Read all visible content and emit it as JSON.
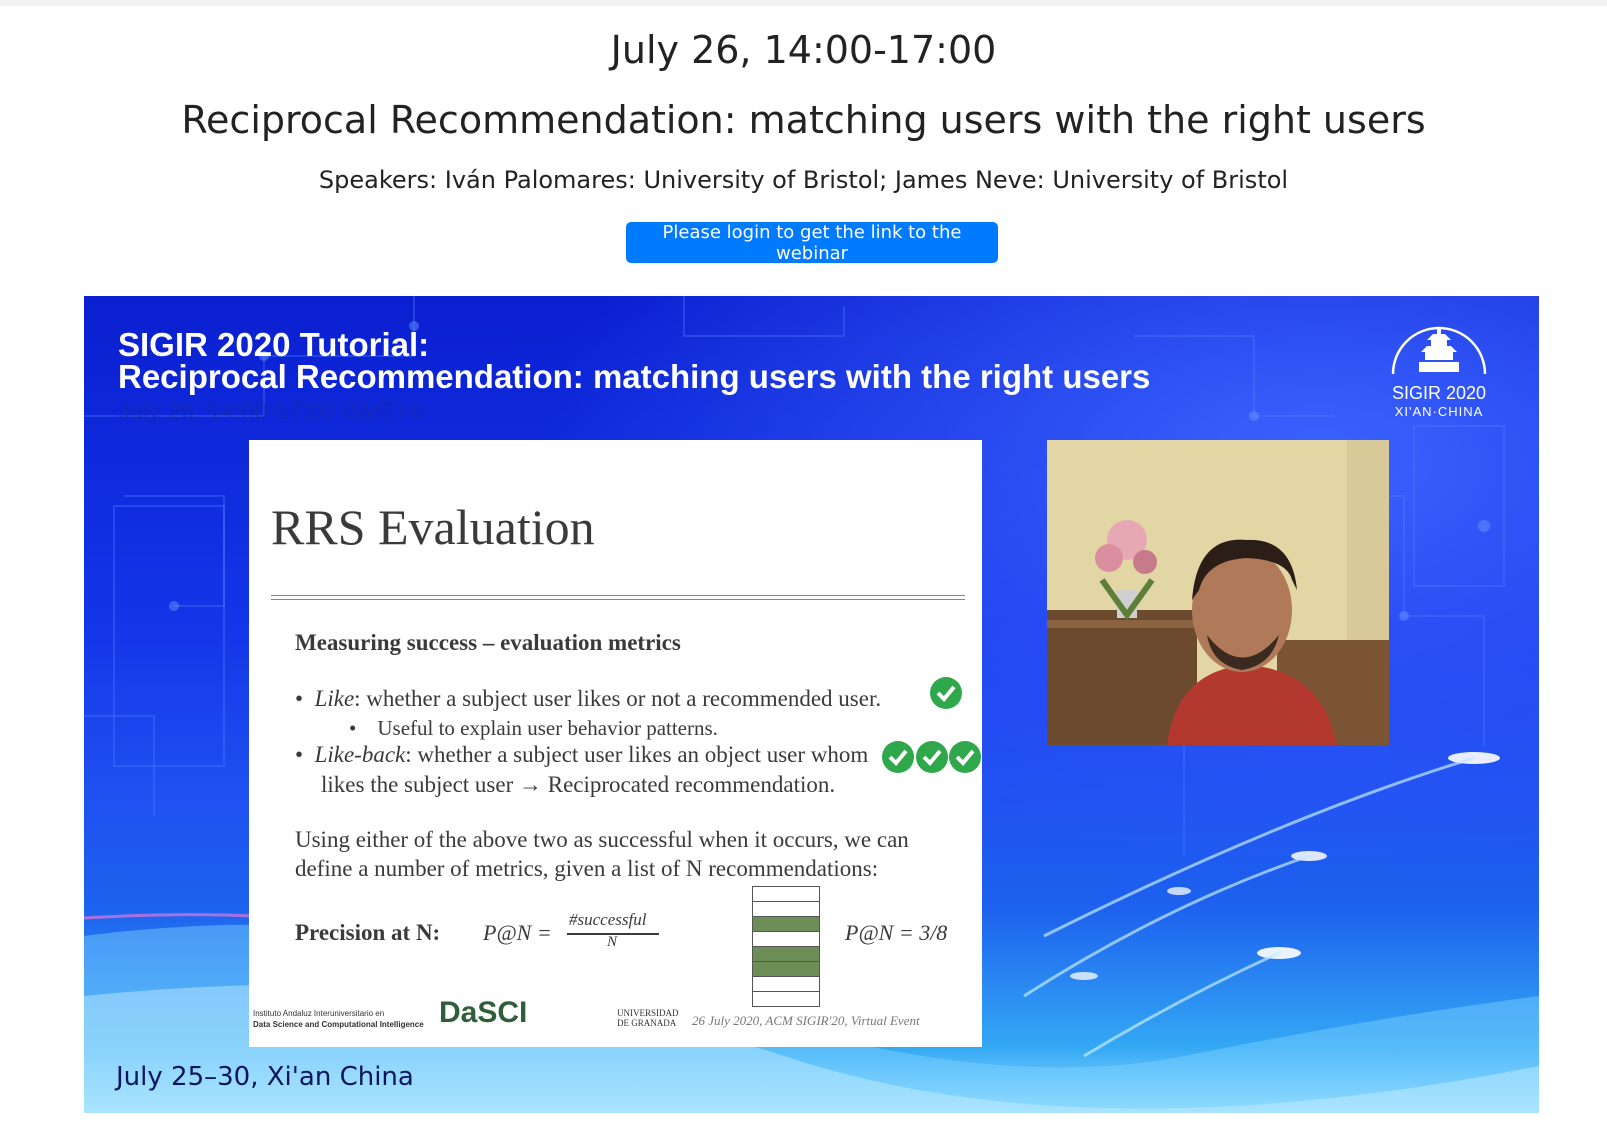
{
  "header": {
    "date": "July 26, 14:00-17:00",
    "title": "Reciprocal Recommendation: matching users with the right users",
    "speakers": "Speakers: Iván Palomares: University of Bristol; James Neve: University of Bristol",
    "login_button": "Please login to get the link to the webinar"
  },
  "video": {
    "banner_line1": "SIGIR 2020 Tutorial:",
    "banner_line2": "Reciprocal  Recommendation: matching users with the right users",
    "ghost_text": "July 26, 14:00-17:00 GMT+8",
    "logo_line1": "SIGIR 2020",
    "logo_line2": "XI'AN·CHINA",
    "location": "July 25–30,  Xi'an China",
    "slide": {
      "title": "RRS Evaluation",
      "subheading": "Measuring success – evaluation metrics",
      "bullet1_term": "Like",
      "bullet1_text": ": whether a subject user likes or not a recommended user.",
      "bullet1_sub": "Useful to explain user behavior patterns.",
      "bullet2_term": "Like-back",
      "bullet2_text": ": whether a subject user likes an object user whom",
      "bullet2_cont": "likes the subject user → Reciprocated recommendation.",
      "para_line1": "Using either of the above two as successful when it occurs, we can",
      "para_line2": "define a number of metrics, given a list of N recommendations:",
      "precision_label": "Precision at N:",
      "formula_lhs": "P@N =",
      "formula_num": "#successful",
      "formula_den": "N",
      "precision_result": "P@N = 3/8",
      "stack_cells": [
        false,
        false,
        true,
        false,
        true,
        true,
        false,
        false
      ],
      "footer_institute_line1": "Instituto Andaluz Interuniversitario en",
      "footer_institute_line2": "Data Science and Computational Intelligence",
      "footer_logo": "DaSCI",
      "footer_univ_line1": "UNIVERSIDAD",
      "footer_univ_line2": "DE GRANADA",
      "footer_event": "26 July 2020, ACM SIGIR'20, Virtual Event"
    }
  },
  "colors": {
    "button_blue": "#007bff",
    "check_green": "#2ea84a",
    "stack_green": "#6e8e57"
  }
}
